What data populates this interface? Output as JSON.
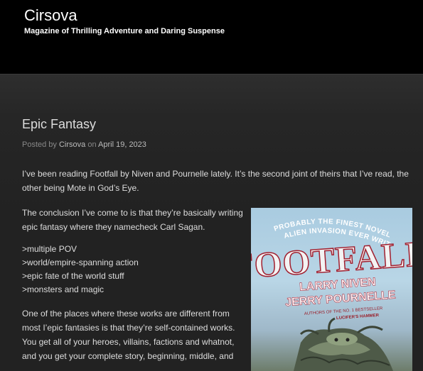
{
  "header": {
    "title": "Cirsova",
    "tagline": "Magazine of Thrilling Adventure and Daring Suspense"
  },
  "post": {
    "title": "Epic Fantasy",
    "meta_prefix": "Posted by ",
    "author": "Cirsova",
    "meta_mid": " on ",
    "date": "April 19, 2023",
    "paragraph1": "I’ve been reading Footfall by Niven and Pournelle lately. It’s the second joint of theirs that I’ve read, the other being Mote in God’s Eye.",
    "paragraph2": "The conclusion I’ve come to is that they’re basically writing epic fantasy where they namecheck Carl Sagan.",
    "list": [
      ">multiple POV",
      ">world/empire-spanning action",
      ">epic fate of the world stuff",
      ">monsters and magic"
    ],
    "paragraph3": "One of the places where these works are different from most I’epic fantasies is that they’re self-contained works. You get all of your heroes, villains, factions and whatnot, and you get your complete story, beginning, middle, and"
  },
  "cover": {
    "tagline": "PROBABLY THE FINEST NOVEL OF ALIEN INVASION EVER WRITTEN",
    "title": "FOOTFALL",
    "author1": "LARRY NIVEN",
    "author2": "JERRY POURNELLE",
    "credit_line1": "AUTHORS OF THE NO. 1 BESTSELLER",
    "credit_line2": "LUCIFER'S HAMMER"
  }
}
